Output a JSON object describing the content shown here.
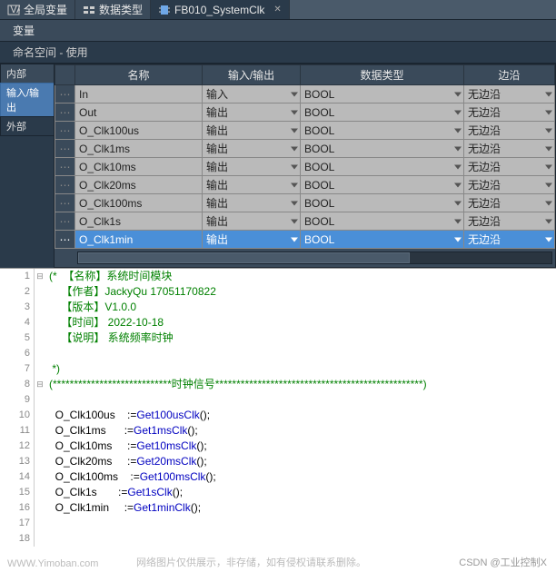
{
  "tabs": {
    "global": "全局变量",
    "types": "数据类型",
    "active": "FB010_SystemClk"
  },
  "varLabel": "变量",
  "nsLabel": "命名空间 - 使用",
  "side": {
    "inner": "内部",
    "io": "输入/输出",
    "outer": "外部"
  },
  "cols": {
    "name": "名称",
    "io": "输入/输出",
    "dtype": "数据类型",
    "edge": "边沿"
  },
  "ioIn": "输入",
  "ioOut": "输出",
  "bool": "BOOL",
  "noedge": "无边沿",
  "rows": [
    {
      "name": "In",
      "io": "输入"
    },
    {
      "name": "Out",
      "io": "输出"
    },
    {
      "name": "O_Clk100us",
      "io": "输出"
    },
    {
      "name": "O_Clk1ms",
      "io": "输出"
    },
    {
      "name": "O_Clk10ms",
      "io": "输出"
    },
    {
      "name": "O_Clk20ms",
      "io": "输出"
    },
    {
      "name": "O_Clk100ms",
      "io": "输出"
    },
    {
      "name": "O_Clk1s",
      "io": "输出"
    },
    {
      "name": "O_Clk1min",
      "io": "输出"
    }
  ],
  "code": [
    {
      "n": 1,
      "t": "comment-start",
      "fold": "⊟",
      "text": "(*  【名称】系统时间模块"
    },
    {
      "n": 2,
      "t": "comment",
      "text": "    【作者】JackyQu 17051170822"
    },
    {
      "n": 3,
      "t": "comment",
      "text": "    【版本】V1.0.0"
    },
    {
      "n": 4,
      "t": "comment",
      "text": "    【时间】 2022-10-18"
    },
    {
      "n": 5,
      "t": "comment",
      "text": "    【说明】 系统频率时钟"
    },
    {
      "n": 6,
      "t": "blank",
      "text": ""
    },
    {
      "n": 7,
      "t": "comment-end",
      "text": " *)"
    },
    {
      "n": 8,
      "t": "comment",
      "fold": "⊟",
      "text": "(****************************时钟信号*************************************************)"
    },
    {
      "n": 9,
      "t": "blank",
      "text": ""
    },
    {
      "n": 10,
      "t": "assign",
      "lhs": "O_Clk100us",
      "fn": "Get100usClk"
    },
    {
      "n": 11,
      "t": "assign",
      "lhs": "O_Clk1ms",
      "fn": "Get1msClk"
    },
    {
      "n": 12,
      "t": "assign",
      "lhs": "O_Clk10ms",
      "fn": "Get10msClk"
    },
    {
      "n": 13,
      "t": "assign",
      "lhs": "O_Clk20ms",
      "fn": "Get20msClk"
    },
    {
      "n": 14,
      "t": "assign",
      "lhs": "O_Clk100ms",
      "fn": "Get100msClk"
    },
    {
      "n": 15,
      "t": "assign",
      "lhs": "O_Clk1s",
      "fn": "Get1sClk"
    },
    {
      "n": 16,
      "t": "assign",
      "lhs": "O_Clk1min",
      "fn": "Get1minClk"
    },
    {
      "n": 17,
      "t": "blank",
      "text": ""
    },
    {
      "n": 18,
      "t": "blank",
      "text": ""
    }
  ],
  "wm": {
    "left": "WWW.Yimoban.com",
    "mid": "网络图片仅供展示，非存储，如有侵权请联系删除。",
    "right": "CSDN @工业控制X"
  }
}
